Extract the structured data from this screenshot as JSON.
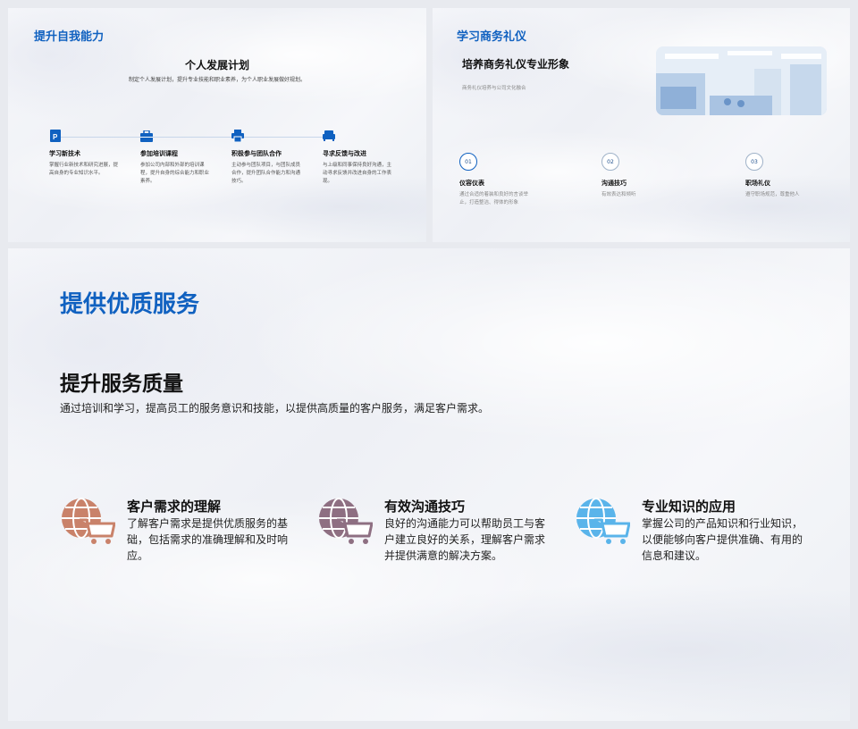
{
  "slide1": {
    "corner_title": "提升自我能力",
    "plan_title": "个人发展计划",
    "plan_subtitle": "制定个人发展计划，提升专业技能和职业素养，为个人职业发展做好规划。",
    "steps": [
      {
        "title": "学习新技术",
        "desc": "掌握行业新技术和研究进展，提高自身的专业知识水平。",
        "icon": "document-icon"
      },
      {
        "title": "参加培训课程",
        "desc": "参加公司内部和外部的培训课程，提升自身的综合能力和职业素养。",
        "icon": "briefcase-icon"
      },
      {
        "title": "积极参与团队合作",
        "desc": "主动参与团队项目，与团队成员合作，提升团队合作能力和沟通技巧。",
        "icon": "printer-icon"
      },
      {
        "title": "寻求反馈与改进",
        "desc": "与上级和同事保持良好沟通，主动寻求反馈并改进自身的工作表现。",
        "icon": "sofa-icon"
      }
    ]
  },
  "slide2": {
    "corner_title": "学习商务礼仪",
    "heading": "培养商务礼仪专业形象",
    "subtitle": "商务礼仪培养与公司文化融合",
    "items": [
      {
        "num": "01",
        "title": "仪容仪表",
        "desc": "通过合适的着装和良好的言谈举止，打造整洁、得体的形象"
      },
      {
        "num": "02",
        "title": "沟通技巧",
        "desc": "有效表达和倾听"
      },
      {
        "num": "03",
        "title": "职场礼仪",
        "desc": "遵守职场规范，尊重他人"
      }
    ]
  },
  "slide3": {
    "title": "提供优质服务",
    "heading": "提升服务质量",
    "description": "通过培训和学习，提高员工的服务意识和技能，以提供高质量的客户服务，满足客户需求。",
    "features": [
      {
        "title": "客户需求的理解",
        "desc": "了解客户需求是提供优质服务的基础，包括需求的准确理解和及时响应。",
        "icon": "global-cart-icon",
        "color": "#c9826a"
      },
      {
        "title": "有效沟通技巧",
        "desc": "良好的沟通能力可以帮助员工与客户建立良好的关系，理解客户需求并提供满意的解决方案。",
        "icon": "global-cart-icon",
        "color": "#8e6f82"
      },
      {
        "title": "专业知识的应用",
        "desc": "掌握公司的产品知识和行业知识，以便能够向客户提供准确、有用的信息和建议。",
        "icon": "global-cart-icon",
        "color": "#5ab4ea"
      }
    ]
  },
  "colors": {
    "accent": "#1061c0"
  }
}
